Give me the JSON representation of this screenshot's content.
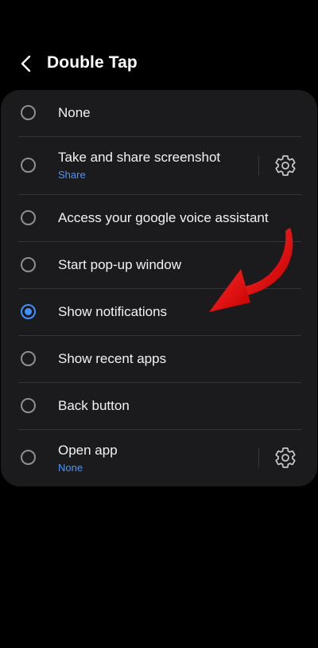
{
  "header": {
    "title": "Double Tap"
  },
  "options": [
    {
      "label": "None",
      "sub": ""
    },
    {
      "label": "Take and share screenshot",
      "sub": "Share"
    },
    {
      "label": "Access your google voice assistant",
      "sub": ""
    },
    {
      "label": "Start pop-up window",
      "sub": ""
    },
    {
      "label": "Show notifications",
      "sub": ""
    },
    {
      "label": "Show recent apps",
      "sub": ""
    },
    {
      "label": "Back button",
      "sub": ""
    },
    {
      "label": "Open app",
      "sub": "None"
    }
  ],
  "selected_option": "Show notifications",
  "colors": {
    "background": "#000000",
    "card": "#1b1b1d",
    "accent": "#3e91ff",
    "annotation_arrow": "#e00000"
  },
  "icons": {
    "back": "chevron-left-icon",
    "settings": "gear-icon",
    "annotation": "red-curved-arrow-icon"
  }
}
